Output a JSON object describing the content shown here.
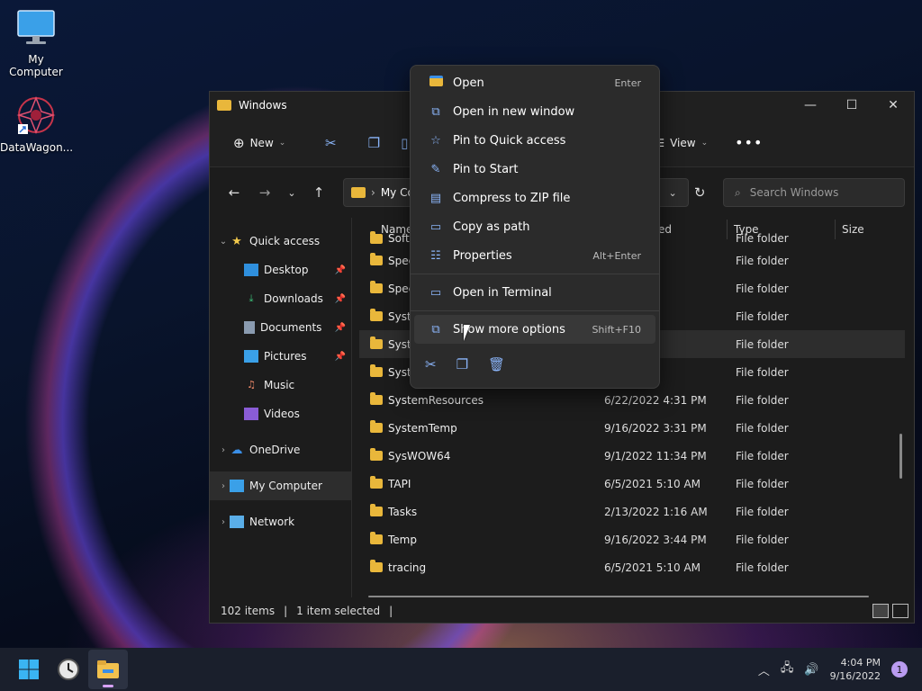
{
  "desktop": {
    "icons": [
      {
        "label": "My Computer",
        "icon": "monitor-icon"
      },
      {
        "label": "DataWagon...",
        "icon": "datawagon-icon"
      }
    ]
  },
  "window": {
    "title": "Windows",
    "toolbar": {
      "new_label": "New",
      "view_label": "View"
    },
    "address": {
      "path_label": "My Con"
    },
    "search_placeholder": "Search Windows",
    "sidebar": {
      "quick_access": "Quick access",
      "items": [
        {
          "label": "Desktop",
          "pinned": true
        },
        {
          "label": "Downloads",
          "pinned": true
        },
        {
          "label": "Documents",
          "pinned": true
        },
        {
          "label": "Pictures",
          "pinned": true
        },
        {
          "label": "Music",
          "pinned": false
        },
        {
          "label": "Videos",
          "pinned": false
        }
      ],
      "onedrive": "OneDrive",
      "my_computer": "My Computer",
      "network": "Network"
    },
    "columns": {
      "name": "Name",
      "modified": "ed",
      "type": "Type",
      "size": "Size"
    },
    "rows": [
      {
        "name": "Softw",
        "date": "40 PM",
        "type": "File folder"
      },
      {
        "name": "Spee",
        "date": "0 AM",
        "type": "File folder"
      },
      {
        "name": "Spee",
        "date": "0 AM",
        "type": "File folder"
      },
      {
        "name": "Syste",
        "date": "0 AM",
        "type": "File folder"
      },
      {
        "name": "Syste",
        "date": "31 PM",
        "type": "File folder"
      },
      {
        "name": "Syste",
        "date": "0 AM",
        "type": "File folder"
      },
      {
        "name": "SystemResources",
        "date": "6/22/2022 4:31 PM",
        "type": "File folder"
      },
      {
        "name": "SystemTemp",
        "date": "9/16/2022 3:31 PM",
        "type": "File folder"
      },
      {
        "name": "SysWOW64",
        "date": "9/1/2022 11:34 PM",
        "type": "File folder"
      },
      {
        "name": "TAPI",
        "date": "6/5/2021 5:10 AM",
        "type": "File folder"
      },
      {
        "name": "Tasks",
        "date": "2/13/2022 1:16 AM",
        "type": "File folder"
      },
      {
        "name": "Temp",
        "date": "9/16/2022 3:44 PM",
        "type": "File folder"
      },
      {
        "name": "tracing",
        "date": "6/5/2021 5:10 AM",
        "type": "File folder"
      }
    ],
    "status": {
      "items": "102 items",
      "selected": "1 item selected"
    }
  },
  "context_menu": {
    "items": [
      {
        "label": "Open",
        "shortcut": "Enter",
        "icon": "folder-open-icon"
      },
      {
        "label": "Open in new window",
        "shortcut": "",
        "icon": "new-window-icon"
      },
      {
        "label": "Pin to Quick access",
        "shortcut": "",
        "icon": "star-icon"
      },
      {
        "label": "Pin to Start",
        "shortcut": "",
        "icon": "pin-icon"
      },
      {
        "label": "Compress to ZIP file",
        "shortcut": "",
        "icon": "zip-icon"
      },
      {
        "label": "Copy as path",
        "shortcut": "",
        "icon": "path-icon"
      },
      {
        "label": "Properties",
        "shortcut": "Alt+Enter",
        "icon": "properties-icon"
      },
      {
        "label": "Open in Terminal",
        "shortcut": "",
        "icon": "terminal-icon"
      },
      {
        "label": "Show more options",
        "shortcut": "Shift+F10",
        "icon": "more-options-icon"
      }
    ]
  },
  "taskbar": {
    "time": "4:04 PM",
    "date": "9/16/2022",
    "notification_count": "1"
  },
  "colors": {
    "accent": "#8ab4f8",
    "folder": "#e9b73b",
    "badge": "#b99bf0"
  }
}
